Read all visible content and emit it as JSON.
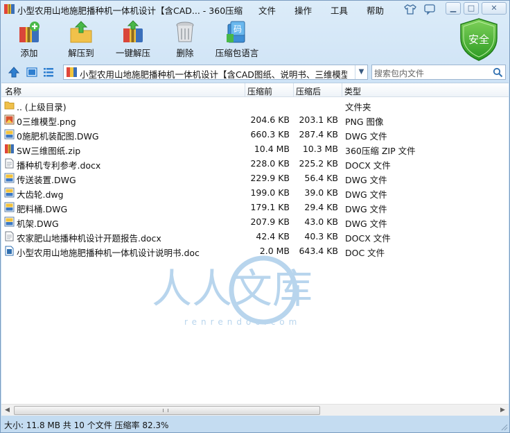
{
  "window": {
    "title": "小型农用山地施肥播种机一体机设计【含CAD... - 360压缩",
    "menus": [
      "文件",
      "操作",
      "工具",
      "帮助"
    ]
  },
  "toolbar": {
    "buttons": [
      {
        "label": "添加",
        "icon": "add-archive-icon"
      },
      {
        "label": "解压到",
        "icon": "extract-to-icon"
      },
      {
        "label": "一键解压",
        "icon": "one-click-extract-icon"
      },
      {
        "label": "删除",
        "icon": "trash-icon"
      },
      {
        "label": "压缩包语言",
        "icon": "archive-language-icon"
      }
    ],
    "security_badge": "安全"
  },
  "address": {
    "path": "小型农用山地施肥播种机一体机设计【含CAD图纸、说明书、三维模型】",
    "search_placeholder": "搜索包内文件"
  },
  "columns": {
    "name": "名称",
    "packed": "压缩前",
    "compressed": "压缩后",
    "type": "类型"
  },
  "files": [
    {
      "icon": "folder-up-icon",
      "name": ".. (上级目录)",
      "packed": "",
      "compressed": "",
      "type": "文件夹"
    },
    {
      "icon": "png-file-icon",
      "name": "0三维模型.png",
      "packed": "204.6 KB",
      "compressed": "203.1 KB",
      "type": "PNG 图像"
    },
    {
      "icon": "dwg-file-icon",
      "name": "0施肥机装配图.DWG",
      "packed": "660.3 KB",
      "compressed": "287.4 KB",
      "type": "DWG 文件"
    },
    {
      "icon": "zip-file-icon",
      "name": "SW三维图纸.zip",
      "packed": "10.4 MB",
      "compressed": "10.3 MB",
      "type": "360压缩 ZIP 文件"
    },
    {
      "icon": "docx-file-icon",
      "name": "播种机专利参考.docx",
      "packed": "228.0 KB",
      "compressed": "225.2 KB",
      "type": "DOCX 文件"
    },
    {
      "icon": "dwg-file-icon",
      "name": "传送装置.DWG",
      "packed": "229.9 KB",
      "compressed": "56.4 KB",
      "type": "DWG 文件"
    },
    {
      "icon": "dwg-file-icon",
      "name": "大齿轮.dwg",
      "packed": "199.0 KB",
      "compressed": "39.0 KB",
      "type": "DWG 文件"
    },
    {
      "icon": "dwg-file-icon",
      "name": "肥料桶.DWG",
      "packed": "179.1 KB",
      "compressed": "29.4 KB",
      "type": "DWG 文件"
    },
    {
      "icon": "dwg-file-icon",
      "name": "机架.DWG",
      "packed": "207.9 KB",
      "compressed": "43.0 KB",
      "type": "DWG 文件"
    },
    {
      "icon": "docx-file-icon",
      "name": "农家肥山地播种机设计开题报告.docx",
      "packed": "42.4 KB",
      "compressed": "40.3 KB",
      "type": "DOCX 文件"
    },
    {
      "icon": "doc-file-icon",
      "name": "小型农用山地施肥播种机一体机设计说明书.doc",
      "packed": "2.0 MB",
      "compressed": "643.4 KB",
      "type": "DOC 文件"
    }
  ],
  "watermark": {
    "text": "人人文库",
    "url": "renrendoc.com"
  },
  "status": {
    "text": "大小: 11.8 MB 共 10 个文件 压缩率 82.3%"
  },
  "colors": {
    "accent": "#2f7fd0",
    "shield": "#3fae2a",
    "watermark": "#6fa8dc"
  }
}
